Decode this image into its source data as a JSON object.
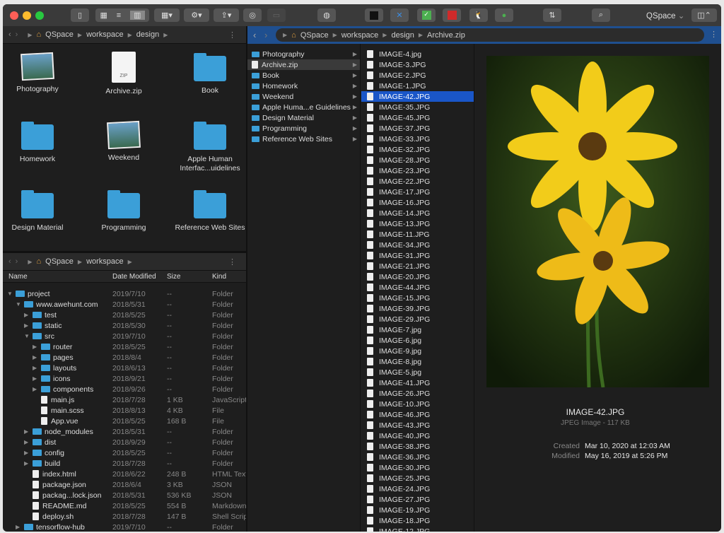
{
  "toolbar": {
    "account": "QSpace"
  },
  "left_top": {
    "path": [
      "QSpace",
      "workspace",
      "design"
    ],
    "items": [
      {
        "label": "Photography",
        "kind": "photos"
      },
      {
        "label": "Archive.zip",
        "kind": "zip"
      },
      {
        "label": "Book",
        "kind": "folder"
      },
      {
        "label": "Homework",
        "kind": "folder"
      },
      {
        "label": "Weekend",
        "kind": "photos"
      },
      {
        "label": "Apple Human Interfac...uidelines",
        "kind": "folder"
      },
      {
        "label": "Design Material",
        "kind": "folder"
      },
      {
        "label": "Programming",
        "kind": "folder"
      },
      {
        "label": "Reference Web Sites",
        "kind": "folder"
      }
    ],
    "zip_badge": "ZIP"
  },
  "left_bottom": {
    "path": [
      "QSpace",
      "workspace"
    ],
    "columns": [
      "Name",
      "Date Modified",
      "Size",
      "Kind"
    ],
    "rows": [
      {
        "name": "project",
        "date": "2019/7/10",
        "size": "--",
        "kind": "Folder",
        "depth": 0,
        "type": "folder",
        "open": true
      },
      {
        "name": "www.awehunt.com",
        "date": "2018/5/31",
        "size": "--",
        "kind": "Folder",
        "depth": 1,
        "type": "folder",
        "open": true
      },
      {
        "name": "test",
        "date": "2018/5/25",
        "size": "--",
        "kind": "Folder",
        "depth": 2,
        "type": "folder"
      },
      {
        "name": "static",
        "date": "2018/5/30",
        "size": "--",
        "kind": "Folder",
        "depth": 2,
        "type": "folder"
      },
      {
        "name": "src",
        "date": "2019/7/10",
        "size": "--",
        "kind": "Folder",
        "depth": 2,
        "type": "folder",
        "open": true
      },
      {
        "name": "router",
        "date": "2018/5/25",
        "size": "--",
        "kind": "Folder",
        "depth": 3,
        "type": "folder"
      },
      {
        "name": "pages",
        "date": "2018/8/4",
        "size": "--",
        "kind": "Folder",
        "depth": 3,
        "type": "folder"
      },
      {
        "name": "layouts",
        "date": "2018/6/13",
        "size": "--",
        "kind": "Folder",
        "depth": 3,
        "type": "folder"
      },
      {
        "name": "icons",
        "date": "2018/9/21",
        "size": "--",
        "kind": "Folder",
        "depth": 3,
        "type": "folder"
      },
      {
        "name": "components",
        "date": "2018/9/26",
        "size": "--",
        "kind": "Folder",
        "depth": 3,
        "type": "folder"
      },
      {
        "name": "main.js",
        "date": "2018/7/28",
        "size": "1 KB",
        "kind": "JavaScript",
        "depth": 3,
        "type": "file"
      },
      {
        "name": "main.scss",
        "date": "2018/8/13",
        "size": "4 KB",
        "kind": "File",
        "depth": 3,
        "type": "file"
      },
      {
        "name": "App.vue",
        "date": "2018/5/25",
        "size": "168 B",
        "kind": "File",
        "depth": 3,
        "type": "file"
      },
      {
        "name": "node_modules",
        "date": "2018/5/31",
        "size": "--",
        "kind": "Folder",
        "depth": 2,
        "type": "folder"
      },
      {
        "name": "dist",
        "date": "2018/9/29",
        "size": "--",
        "kind": "Folder",
        "depth": 2,
        "type": "folder"
      },
      {
        "name": "config",
        "date": "2018/5/25",
        "size": "--",
        "kind": "Folder",
        "depth": 2,
        "type": "folder"
      },
      {
        "name": "build",
        "date": "2018/7/28",
        "size": "--",
        "kind": "Folder",
        "depth": 2,
        "type": "folder"
      },
      {
        "name": "index.html",
        "date": "2018/6/22",
        "size": "248 B",
        "kind": "HTML Text",
        "depth": 2,
        "type": "file"
      },
      {
        "name": "package.json",
        "date": "2018/6/4",
        "size": "3 KB",
        "kind": "JSON",
        "depth": 2,
        "type": "file"
      },
      {
        "name": "packag...lock.json",
        "date": "2018/5/31",
        "size": "536 KB",
        "kind": "JSON",
        "depth": 2,
        "type": "file"
      },
      {
        "name": "README.md",
        "date": "2018/5/25",
        "size": "554 B",
        "kind": "Markdown",
        "depth": 2,
        "type": "file"
      },
      {
        "name": "deploy.sh",
        "date": "2018/7/28",
        "size": "147 B",
        "kind": "Shell Scrip",
        "depth": 2,
        "type": "file"
      },
      {
        "name": "tensorflow-hub",
        "date": "2019/7/10",
        "size": "--",
        "kind": "Folder",
        "depth": 1,
        "type": "folder"
      }
    ]
  },
  "right": {
    "path": [
      "QSpace",
      "workspace",
      "design",
      "Archive.zip"
    ],
    "col1": [
      "Photography",
      "Archive.zip",
      "Book",
      "Homework",
      "Weekend",
      "Apple Huma...e Guidelines",
      "Design Material",
      "Programming",
      "Reference Web Sites"
    ],
    "col1_selected": 1,
    "col2": [
      "IMAGE-4.jpg",
      "IMAGE-3.JPG",
      "IMAGE-2.JPG",
      "IMAGE-1.JPG",
      "IMAGE-42.JPG",
      "IMAGE-35.JPG",
      "IMAGE-45.JPG",
      "IMAGE-37.JPG",
      "IMAGE-33.JPG",
      "IMAGE-32.JPG",
      "IMAGE-28.JPG",
      "IMAGE-23.JPG",
      "IMAGE-22.JPG",
      "IMAGE-17.JPG",
      "IMAGE-16.JPG",
      "IMAGE-14.JPG",
      "IMAGE-13.JPG",
      "IMAGE-11.JPG",
      "IMAGE-34.JPG",
      "IMAGE-31.JPG",
      "IMAGE-21.JPG",
      "IMAGE-20.JPG",
      "IMAGE-44.JPG",
      "IMAGE-15.JPG",
      "IMAGE-39.JPG",
      "IMAGE-29.JPG",
      "IMAGE-7.jpg",
      "IMAGE-6.jpg",
      "IMAGE-9.jpg",
      "IMAGE-8.jpg",
      "IMAGE-5.jpg",
      "IMAGE-41.JPG",
      "IMAGE-26.JPG",
      "IMAGE-10.JPG",
      "IMAGE-46.JPG",
      "IMAGE-43.JPG",
      "IMAGE-40.JPG",
      "IMAGE-38.JPG",
      "IMAGE-36.JPG",
      "IMAGE-30.JPG",
      "IMAGE-25.JPG",
      "IMAGE-24.JPG",
      "IMAGE-27.JPG",
      "IMAGE-19.JPG",
      "IMAGE-18.JPG",
      "IMAGE-12.JPG"
    ],
    "col2_selected": 4,
    "preview": {
      "name": "IMAGE-42.JPG",
      "subtitle": "JPEG Image - 117 KB",
      "created_label": "Created",
      "created": "Mar 10, 2020 at 12:03 AM",
      "modified_label": "Modified",
      "modified": "May 16, 2019 at 5:26 PM"
    }
  }
}
